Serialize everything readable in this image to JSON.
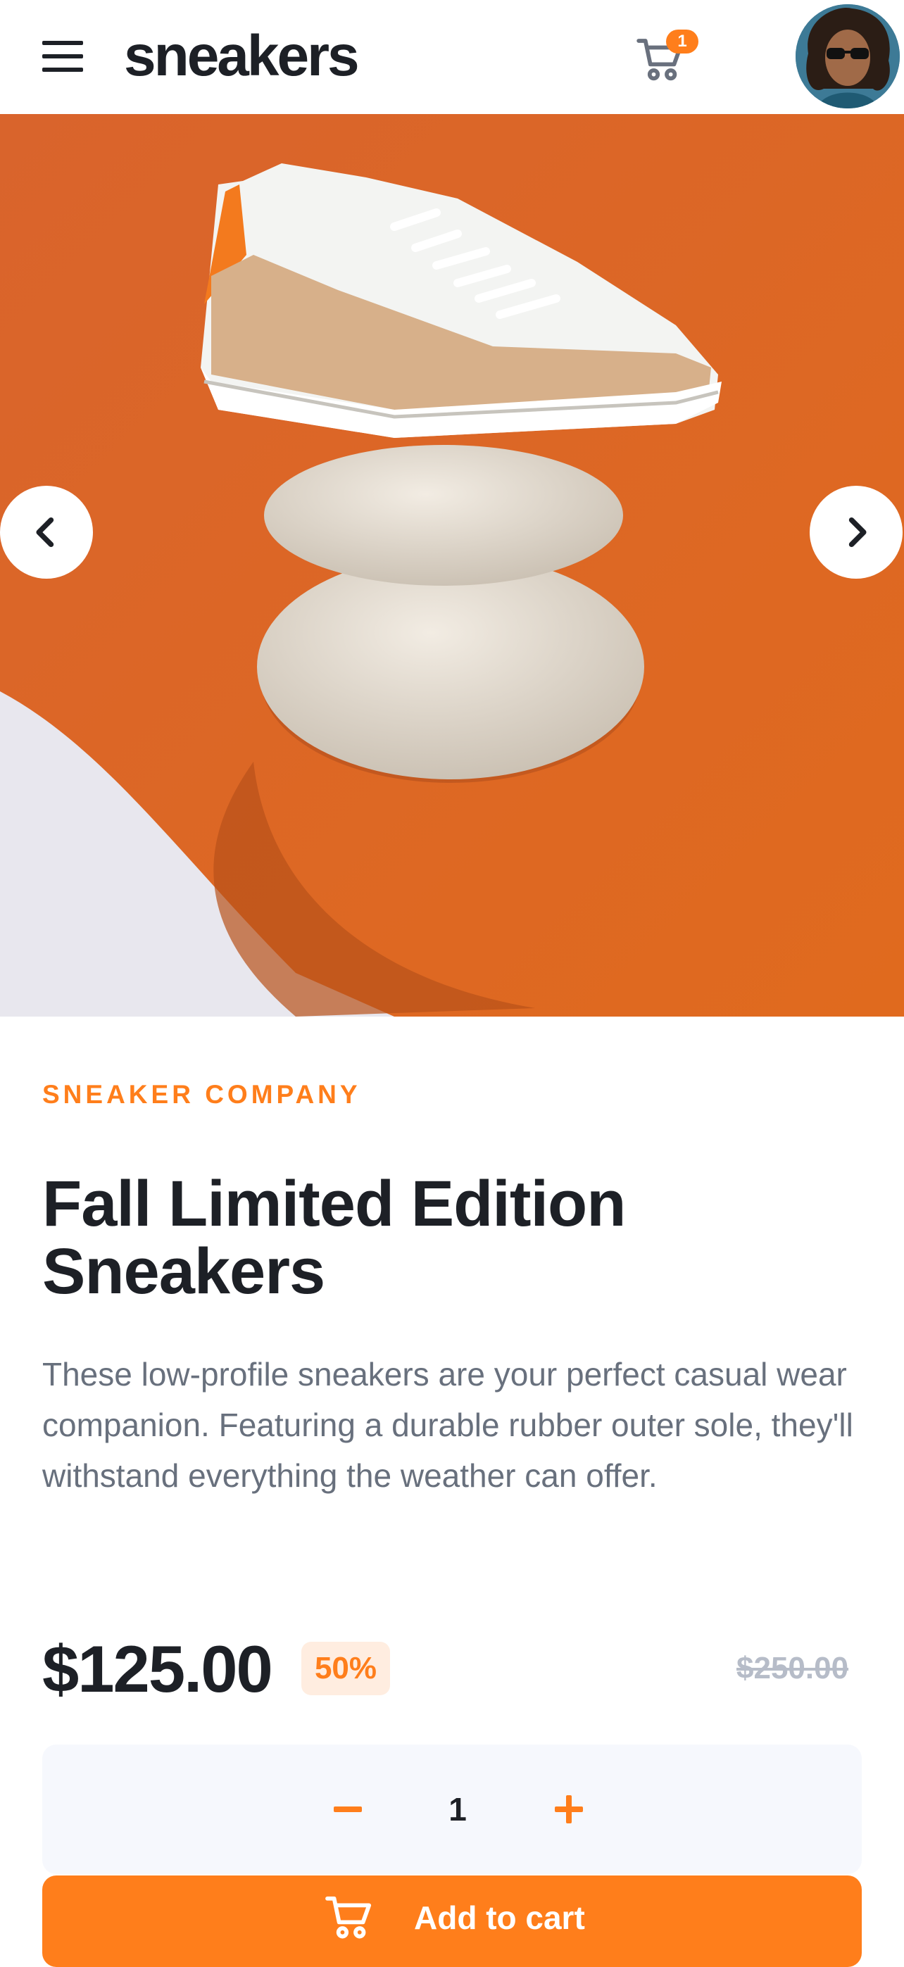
{
  "header": {
    "logo": "sneakers",
    "cart_count": "1"
  },
  "gallery": {
    "image_desc": "white and tan sneaker on stacked stones, orange backdrop"
  },
  "product": {
    "company": "SNEAKER COMPANY",
    "title": "Fall Limited Edition Sneakers",
    "description": "These low-profile sneakers are your perfect casual wear companion. Featuring a durable rubber outer sole, they'll withstand everything the weather can offer.",
    "price": "$125.00",
    "discount": "50%",
    "original_price": "$250.00"
  },
  "quantity": {
    "value": "1"
  },
  "cta": {
    "add_to_cart": "Add to cart"
  },
  "colors": {
    "accent": "#ff7e1b",
    "accent_pale": "#ffede0",
    "text_dark": "#1d2026",
    "text_gray": "#68707d",
    "qty_bg": "#f6f8fd"
  }
}
